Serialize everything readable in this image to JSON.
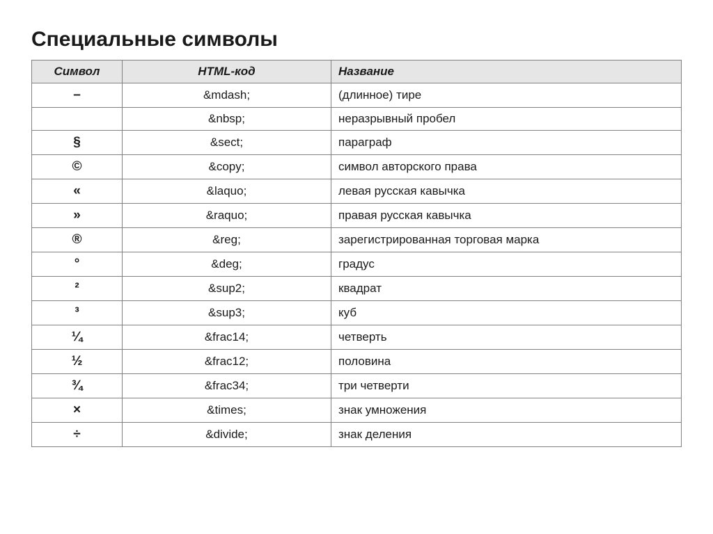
{
  "title": "Специальные символы",
  "headers": {
    "symbol": "Символ",
    "code": "HTML-код",
    "name": "Название"
  },
  "rows": [
    {
      "symbol": "–",
      "code": "&mdash;",
      "name": "(длинное) тире"
    },
    {
      "symbol": "",
      "code": "&nbsp;",
      "name": "неразрывный пробел"
    },
    {
      "symbol": "§",
      "code": "&sect;",
      "name": "параграф"
    },
    {
      "symbol": "©",
      "code": "&copy;",
      "name": "символ авторского права"
    },
    {
      "symbol": "«",
      "code": "&laquo;",
      "name": "левая русская кавычка"
    },
    {
      "symbol": "»",
      "code": "&raquo;",
      "name": "правая русская кавычка"
    },
    {
      "symbol": "®",
      "code": "&reg;",
      "name": "зарегистрированная торговая марка"
    },
    {
      "symbol": "°",
      "code": "&deg;",
      "name": "градус"
    },
    {
      "symbol": "²",
      "code": "&sup2;",
      "name": "квадрат"
    },
    {
      "symbol": "³",
      "code": "&sup3;",
      "name": "куб"
    },
    {
      "symbol": "¼",
      "code": "&frac14;",
      "name": "четверть"
    },
    {
      "symbol": "½",
      "code": "&frac12;",
      "name": "половина"
    },
    {
      "symbol": "¾",
      "code": "&frac34;",
      "name": "три четверти"
    },
    {
      "symbol": "×",
      "code": "&times;",
      "name": "знак умножения"
    },
    {
      "symbol": "÷",
      "code": "&divide;",
      "name": "знак деления"
    }
  ]
}
